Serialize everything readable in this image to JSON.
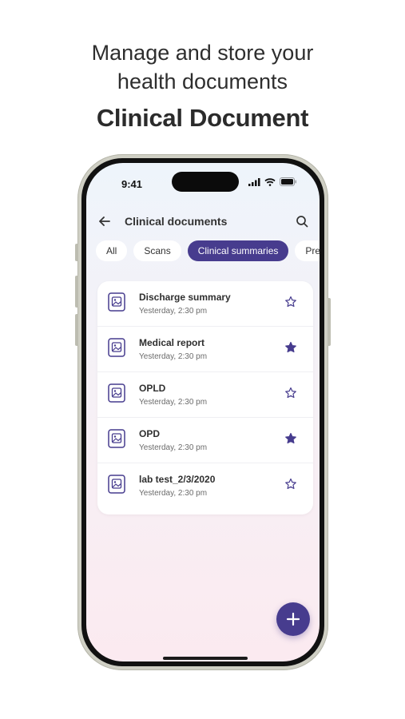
{
  "promo": {
    "headline_line1": "Manage and store your",
    "headline_line2": "health documents",
    "title": "Clinical Document"
  },
  "status_bar": {
    "time": "9:41"
  },
  "header": {
    "title": "Clinical documents"
  },
  "chips": [
    {
      "label": "All",
      "active": false
    },
    {
      "label": "Scans",
      "active": false
    },
    {
      "label": "Clinical summaries",
      "active": true
    },
    {
      "label": "Pres",
      "active": false
    }
  ],
  "documents": [
    {
      "name": "Discharge summary",
      "time": "Yesterday, 2:30 pm",
      "starred": false
    },
    {
      "name": "Medical report",
      "time": "Yesterday, 2:30 pm",
      "starred": true
    },
    {
      "name": "OPLD",
      "time": "Yesterday, 2:30 pm",
      "starred": false
    },
    {
      "name": "OPD",
      "time": "Yesterday, 2:30 pm",
      "starred": true
    },
    {
      "name": "lab test_2/3/2020",
      "time": "Yesterday, 2:30 pm",
      "starred": false
    }
  ],
  "colors": {
    "accent": "#473c8e"
  },
  "icons": {
    "back": "arrow-left-icon",
    "search": "search-icon",
    "document": "image-document-icon",
    "star": "star-icon",
    "add": "plus-icon"
  }
}
